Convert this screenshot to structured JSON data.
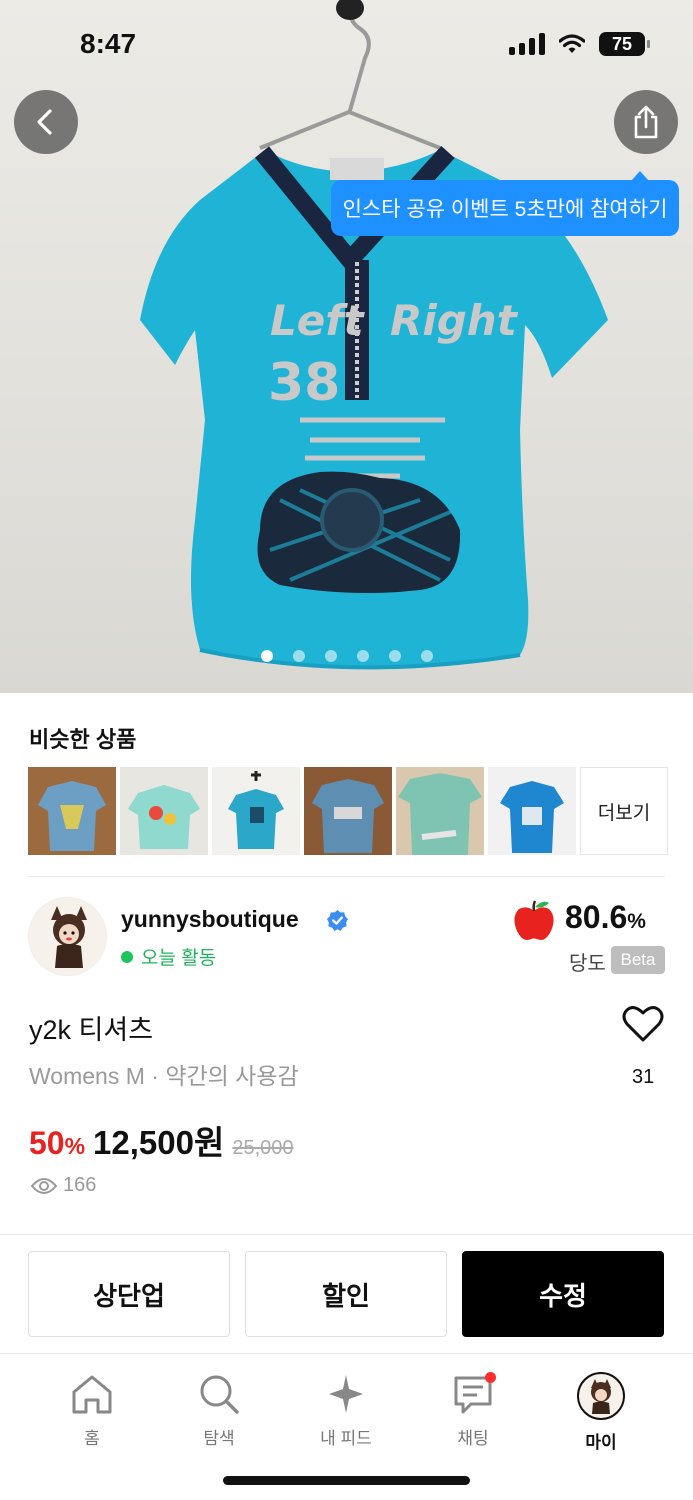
{
  "status_bar": {
    "time": "8:47",
    "battery": "75"
  },
  "tooltip": {
    "text": "인스타 공유 이벤트 5초만에 참여하기"
  },
  "carousel": {
    "total": 6,
    "active_index": 1
  },
  "similar": {
    "title": "비슷한 상품",
    "more_label": "더보기",
    "thumbnails": [
      "similar-item-1",
      "similar-item-2",
      "similar-item-3",
      "similar-item-4",
      "similar-item-5",
      "similar-item-6"
    ]
  },
  "seller": {
    "name": "yunnysboutique",
    "activity": "오늘 활동",
    "score_value": "80.6",
    "score_unit": "%",
    "score_label": "당도",
    "beta": "Beta"
  },
  "product": {
    "title": "y2k 티셔츠",
    "meta": "Womens M · 약간의 사용감",
    "likes": "31",
    "discount_value": "50",
    "discount_unit": "%",
    "price": "12,500원",
    "original_price": "25,000",
    "views": "166"
  },
  "actions": {
    "bump": "상단업",
    "discount": "할인",
    "edit": "수정"
  },
  "tabs": [
    {
      "label": "홈",
      "icon": "home-icon"
    },
    {
      "label": "탐색",
      "icon": "search-icon"
    },
    {
      "label": "내 피드",
      "icon": "sparkle-icon"
    },
    {
      "label": "채팅",
      "icon": "chat-icon"
    },
    {
      "label": "마이",
      "icon": "profile-avatar"
    }
  ],
  "colors": {
    "accent_blue": "#1e90ff",
    "discount_red": "#e8231f",
    "online_green": "#1fc35e",
    "shirt_blue": "#1fb3d6"
  }
}
